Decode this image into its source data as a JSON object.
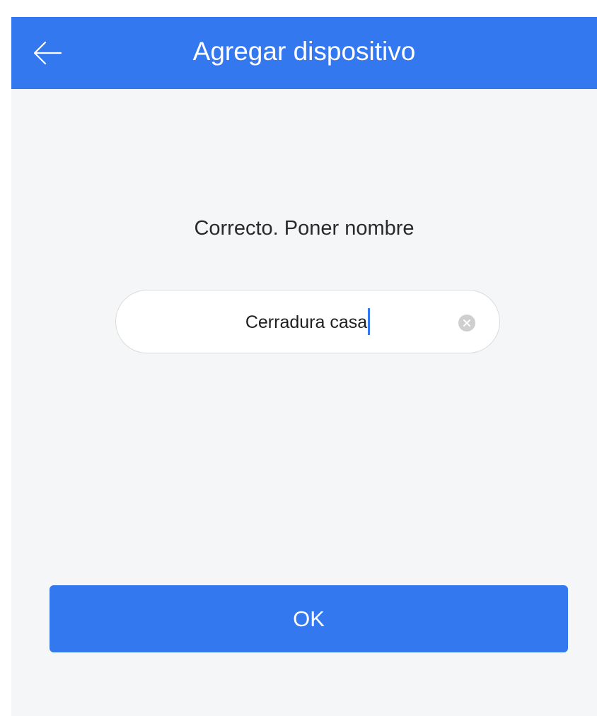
{
  "header": {
    "title": "Agregar dispositivo",
    "back_icon": "arrow-left-icon",
    "color": "#3478f0"
  },
  "main": {
    "prompt": "Correcto. Poner nombre",
    "name_input": {
      "value": "Cerradura casa",
      "clear_icon": "clear-circle-icon"
    },
    "ok_label": "OK"
  },
  "colors": {
    "accent": "#3478f0",
    "background": "#f5f6f8"
  }
}
